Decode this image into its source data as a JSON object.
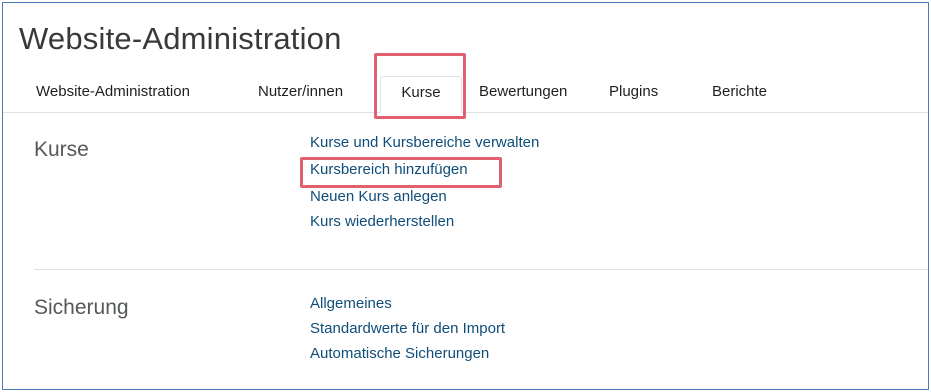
{
  "page_title": "Website-Administration",
  "tabs": [
    {
      "label": "Website-Administration"
    },
    {
      "label": "Nutzer/innen"
    },
    {
      "label": "Kurse",
      "active": true
    },
    {
      "label": "Bewertungen"
    },
    {
      "label": "Plugins"
    },
    {
      "label": "Berichte"
    }
  ],
  "sections": [
    {
      "title": "Kurse",
      "links": [
        "Kurse und Kursbereiche verwalten",
        "Kursbereich hinzufügen",
        "Neuen Kurs anlegen",
        "Kurs wiederherstellen"
      ]
    },
    {
      "title": "Sicherung",
      "links": [
        "Allgemeines",
        "Standardwerte für den Import",
        "Automatische Sicherungen"
      ]
    }
  ],
  "colors": {
    "highlight": "#e0606e",
    "link": "#0f4d7a",
    "frame_border": "#4a7ebb"
  }
}
